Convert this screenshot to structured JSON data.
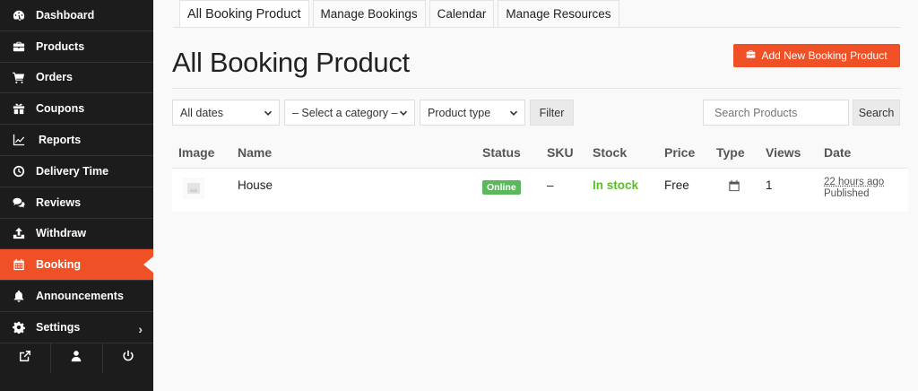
{
  "sidebar": {
    "items": [
      {
        "label": "Dashboard",
        "icon": "dashboard-icon"
      },
      {
        "label": "Products",
        "icon": "briefcase-icon"
      },
      {
        "label": "Orders",
        "icon": "cart-icon"
      },
      {
        "label": "Coupons",
        "icon": "gift-icon"
      },
      {
        "label": "Reports",
        "icon": "chart-line-icon"
      },
      {
        "label": "Delivery Time",
        "icon": "clock-icon"
      },
      {
        "label": "Reviews",
        "icon": "comments-icon"
      },
      {
        "label": "Withdraw",
        "icon": "upload-icon"
      },
      {
        "label": "Booking",
        "icon": "calendar-icon",
        "active": true
      },
      {
        "label": "Announcements",
        "icon": "bell-icon"
      },
      {
        "label": "Settings",
        "icon": "gear-icon",
        "chevron": "›"
      }
    ],
    "bottom": [
      "external-link-icon",
      "user-icon",
      "power-icon"
    ]
  },
  "tabs": [
    "All Booking Product",
    "Manage Bookings",
    "Calendar",
    "Manage Resources"
  ],
  "page_title": "All Booking Product",
  "add_button": "Add New Booking Product",
  "filters": {
    "dates": "All dates",
    "category": "– Select a category –",
    "product_type": "Product type",
    "filter_button": "Filter"
  },
  "search": {
    "placeholder": "Search Products",
    "button": "Search"
  },
  "table": {
    "headers": [
      "Image",
      "Name",
      "Status",
      "SKU",
      "Stock",
      "Price",
      "Type",
      "Views",
      "Date"
    ],
    "rows": [
      {
        "name": "House",
        "status": "Online",
        "sku": "–",
        "stock": "In stock",
        "price": "Free",
        "type_icon": "calendar-icon",
        "views": "1",
        "date": "22 hours ago",
        "date_status": "Published"
      }
    ]
  },
  "colors": {
    "accent": "#f05025",
    "sidebar": "#1c1c1c",
    "online": "#5cb85c",
    "instock": "#5cbd2a"
  }
}
